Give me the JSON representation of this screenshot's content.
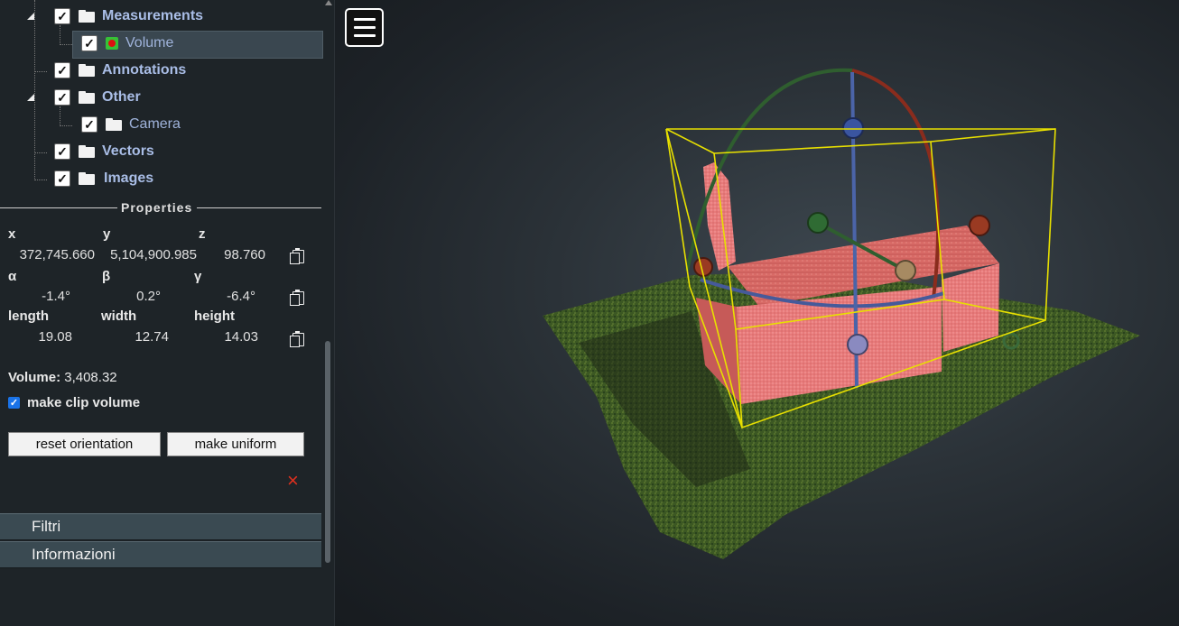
{
  "tree": {
    "measurements": "Measurements",
    "volume": "Volume",
    "annotations": "Annotations",
    "other": "Other",
    "camera": "Camera",
    "vectors": "Vectors",
    "images": "Images"
  },
  "properties": {
    "title": "Properties",
    "x_label": "x",
    "y_label": "y",
    "z_label": "z",
    "x": "372,745.660",
    "y": "5,104,900.985",
    "z": "98.760",
    "alpha_label": "α",
    "beta_label": "β",
    "gamma_label": "γ",
    "alpha": "-1.4°",
    "beta": "0.2°",
    "gamma": "-6.4°",
    "length_label": "length",
    "width_label": "width",
    "height_label": "height",
    "length": "19.08",
    "width": "12.74",
    "height": "14.03",
    "volume_label": "Volume:",
    "volume_value": "3,408.32",
    "clip_label": "make clip volume",
    "reset_label": "reset orientation",
    "uniform_label": "make uniform",
    "delete_icon": "×"
  },
  "accordion": {
    "filters": "Filtri",
    "info": "Informazioni"
  },
  "colors": {
    "sidebar_bg": "#1e2428",
    "tree_label": "#a9bde6",
    "selected_bg": "#3a4750",
    "accordion_bg": "#3a4a52",
    "bbox": "#e8e000",
    "delete": "#e0301e"
  },
  "icons": [
    "menu-icon",
    "folder-icon",
    "volume-icon",
    "copy-icon",
    "close-icon"
  ]
}
